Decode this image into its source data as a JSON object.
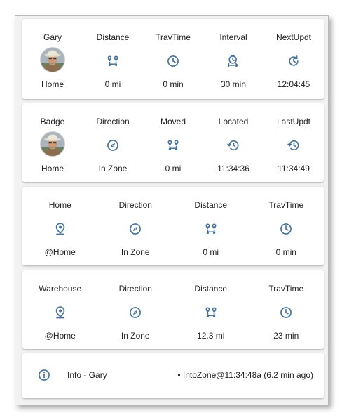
{
  "card1": {
    "labels": [
      "Gary",
      "Distance",
      "TravTime",
      "Interval",
      "NextUpdt"
    ],
    "icons": [
      "avatar",
      "map-marker-distance-icon",
      "clock-icon",
      "timer-interval-icon",
      "update-icon"
    ],
    "values": [
      "Home",
      "0 mi",
      "0 min",
      "30 min",
      "12:04:45"
    ]
  },
  "card2": {
    "labels": [
      "Badge",
      "Direction",
      "Moved",
      "Located",
      "LastUpdt"
    ],
    "icons": [
      "avatar",
      "compass-icon",
      "map-marker-distance-icon",
      "history-icon",
      "history-icon"
    ],
    "values": [
      "Home",
      "In Zone",
      "0 mi",
      "11:34:36",
      "11:34:49"
    ]
  },
  "card3": {
    "labels": [
      "Home",
      "Direction",
      "Distance",
      "TravTime"
    ],
    "icons": [
      "map-marker-icon",
      "compass-icon",
      "map-marker-distance-icon",
      "clock-icon"
    ],
    "values": [
      "@Home",
      "In Zone",
      "0 mi",
      "0 min"
    ]
  },
  "card4": {
    "labels": [
      "Warehouse",
      "Direction",
      "Distance",
      "TravTime"
    ],
    "icons": [
      "map-marker-icon",
      "compass-icon",
      "map-marker-distance-icon",
      "clock-icon"
    ],
    "values": [
      "@Home",
      "In Zone",
      "12.3 mi",
      "23 min"
    ]
  },
  "info": {
    "icon": "information-icon",
    "label": "Info - Gary",
    "message": "• IntoZone@11:34:48a (6.2 min ago)"
  },
  "colors": {
    "icon": "#44739e",
    "text": "#212121",
    "card": "#ffffff",
    "background": "#f2f2f2"
  }
}
